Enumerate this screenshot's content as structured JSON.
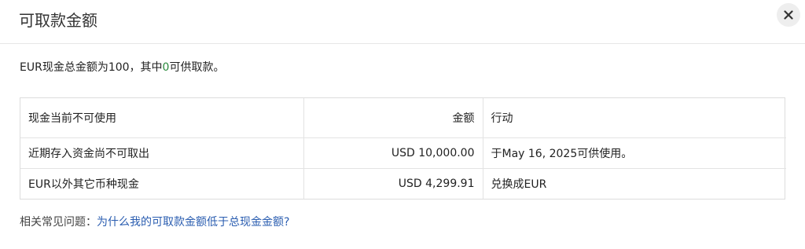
{
  "dialog": {
    "title": "可取款金额",
    "close_icon": "close-icon"
  },
  "summary": {
    "prefix": "EUR现金总金额为100，其中",
    "available": "0",
    "suffix": "可供取款。",
    "available_color": "#2b8a3e"
  },
  "table": {
    "headers": [
      "现金当前不可使用",
      "金额",
      "行动"
    ],
    "rows": [
      {
        "reason": "近期存入资金尚不可取出",
        "amount": "USD 10,000.00",
        "action": "于May 16, 2025可供使用。"
      },
      {
        "reason": "EUR以外其它币种现金",
        "amount": "USD 4,299.91",
        "action": "兑换成EUR"
      }
    ]
  },
  "faq": {
    "label": "相关常见问题：",
    "link": "为什么我的可取款金额低于总现金金额?",
    "link_color": "#2a5db0"
  }
}
